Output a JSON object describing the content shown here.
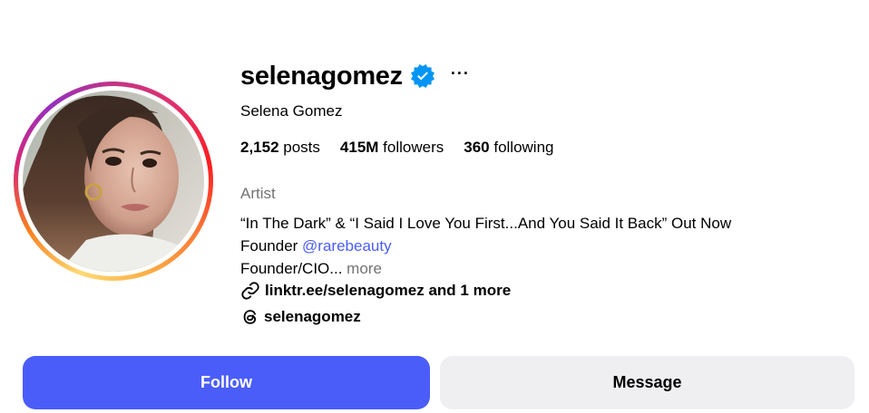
{
  "profile": {
    "username": "selenagomez",
    "full_name": "Selena Gomez",
    "verified_icon": "verified-badge-icon",
    "more_label": "···",
    "avatar_icon": "profile-photo"
  },
  "stats": {
    "posts_count": "2,152",
    "posts_label": " posts",
    "followers_count": "415M",
    "followers_label": " followers",
    "following_count": "360",
    "following_label": " following"
  },
  "bio": {
    "category": "Artist",
    "line1": "“In The Dark” & “I Said I Love You First...And You Said It Back” Out Now",
    "line2_prefix": "Founder ",
    "line2_mention": "@rarebeauty",
    "line3_text": "Founder/CIO...",
    "line3_more": "more",
    "link_text": "linktr.ee/selenagomez and 1 more",
    "link_icon": "link-icon",
    "threads_text": "selenagomez",
    "threads_icon": "threads-icon"
  },
  "actions": {
    "follow_label": "Follow",
    "message_label": "Message"
  },
  "colors": {
    "accent": "#4a5df9",
    "verified": "#0095f6",
    "muted": "#737373",
    "secondary_button": "#efeff2"
  }
}
